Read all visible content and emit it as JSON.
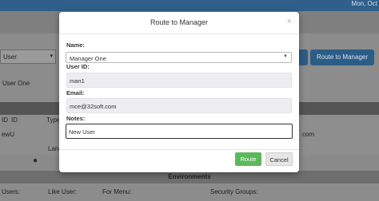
{
  "background": {
    "date_text": "Mon, Oct",
    "user_select_value": "User",
    "user_text": "User One",
    "route_button_label": "Route to Manager",
    "columns": [
      "ID",
      "ID",
      "Type"
    ],
    "row_value": "ewU",
    "email_partial": "com",
    "lang_label": "Lang",
    "environments_header": "Environments",
    "bottom_columns": [
      "Users:",
      "Like User:",
      "For Menu:",
      "Security Groups:"
    ]
  },
  "modal": {
    "title": "Route to Manager",
    "close_symbol": "×",
    "name": {
      "label": "Name:",
      "selected": "Manager One"
    },
    "user_id": {
      "label": "User ID:",
      "value": "man1"
    },
    "email": {
      "label": "Email:",
      "value": "mce@32soft.com"
    },
    "notes": {
      "label": "Notes:",
      "value": "New User"
    },
    "route_button": "Route",
    "cancel_button": "Cancel"
  },
  "colors": {
    "topbar": "#2f5f8a",
    "route_green": "#5cb85c",
    "primary_blue": "#2c5d87"
  }
}
